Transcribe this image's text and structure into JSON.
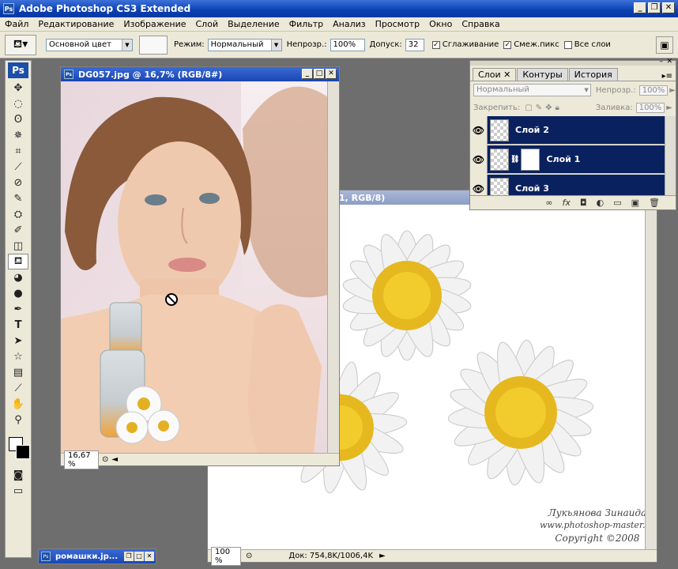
{
  "app": {
    "title": "Adobe Photoshop CS3 Extended",
    "icon_label": "Ps"
  },
  "menu": [
    "Файл",
    "Редактирование",
    "Изображение",
    "Слой",
    "Выделение",
    "Фильтр",
    "Анализ",
    "Просмотр",
    "Окно",
    "Справка"
  ],
  "options": {
    "fill_source": "Основной цвет",
    "mode_label": "Режим:",
    "mode_value": "Нормальный",
    "opacity_label": "Непрозр.:",
    "opacity_value": "100%",
    "tolerance_label": "Допуск:",
    "tolerance_value": "32",
    "antialias": "Сглаживание",
    "contiguous": "Смеж.пикс",
    "all_layers": "Все слои"
  },
  "doc_front": {
    "title": "DG057.jpg @ 16,7% (RGB/8#)",
    "zoom": "16,67 %"
  },
  "doc_back": {
    "title_fragment": "1, RGB/8)",
    "zoom": "100 %",
    "doc_info": "Док: 754,8K/1006,4K",
    "watermark_line1": "Лукьянова Зинаида",
    "watermark_line2": "www.photoshop-master.ru",
    "watermark_line3": "Copyright ©2008"
  },
  "layers_panel": {
    "tabs": [
      "Слои",
      "Контуры",
      "История"
    ],
    "blend_mode": "Нормальный",
    "opacity_label": "Непрозр.:",
    "opacity_value": "100%",
    "lock_label": "Закрепить:",
    "fill_label": "Заливка:",
    "fill_value": "100%",
    "layers": [
      "Слой 2",
      "Слой 1",
      "Слой 3"
    ]
  },
  "minimized_doc": {
    "title": "ромашки.jp..."
  },
  "colors": {
    "title_blue": "#0a3fb3",
    "layer_selected": "#0a2160",
    "chrome": "#ece9d8"
  }
}
